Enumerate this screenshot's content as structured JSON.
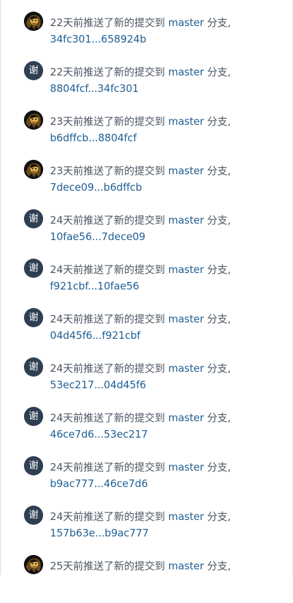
{
  "activities": [
    {
      "avatar_type": "photo",
      "avatar_icon": "user-avatar-icon",
      "prefix": "22天前推送了新的提交到",
      "branch": "master",
      "suffix": "分支,",
      "compare": "34fc301...658924b"
    },
    {
      "avatar_type": "letter",
      "avatar_text": "谢",
      "prefix": "22天前推送了新的提交到",
      "branch": "master",
      "suffix": "分支,",
      "compare": "8804fcf...34fc301"
    },
    {
      "avatar_type": "photo",
      "avatar_icon": "user-avatar-icon",
      "prefix": "23天前推送了新的提交到",
      "branch": "master",
      "suffix": "分支,",
      "compare": "b6dffcb...8804fcf"
    },
    {
      "avatar_type": "photo",
      "avatar_icon": "user-avatar-icon",
      "prefix": "23天前推送了新的提交到",
      "branch": "master",
      "suffix": "分支,",
      "compare": "7dece09...b6dffcb"
    },
    {
      "avatar_type": "letter",
      "avatar_text": "谢",
      "prefix": "24天前推送了新的提交到",
      "branch": "master",
      "suffix": "分支,",
      "compare": "10fae56...7dece09"
    },
    {
      "avatar_type": "letter",
      "avatar_text": "谢",
      "prefix": "24天前推送了新的提交到",
      "branch": "master",
      "suffix": "分支,",
      "compare": "f921cbf...10fae56"
    },
    {
      "avatar_type": "letter",
      "avatar_text": "谢",
      "prefix": "24天前推送了新的提交到",
      "branch": "master",
      "suffix": "分支,",
      "compare": "04d45f6...f921cbf"
    },
    {
      "avatar_type": "letter",
      "avatar_text": "谢",
      "prefix": "24天前推送了新的提交到",
      "branch": "master",
      "suffix": "分支,",
      "compare": "53ec217...04d45f6"
    },
    {
      "avatar_type": "letter",
      "avatar_text": "谢",
      "prefix": "24天前推送了新的提交到",
      "branch": "master",
      "suffix": "分支,",
      "compare": "46ce7d6...53ec217"
    },
    {
      "avatar_type": "letter",
      "avatar_text": "谢",
      "prefix": "24天前推送了新的提交到",
      "branch": "master",
      "suffix": "分支,",
      "compare": "b9ac777...46ce7d6"
    },
    {
      "avatar_type": "letter",
      "avatar_text": "谢",
      "prefix": "24天前推送了新的提交到",
      "branch": "master",
      "suffix": "分支,",
      "compare": "157b63e...b9ac777"
    },
    {
      "avatar_type": "photo",
      "avatar_icon": "user-avatar-icon",
      "prefix": "25天前推送了新的提交到",
      "branch": "master",
      "suffix": "分支,",
      "compare": ""
    }
  ],
  "colors": {
    "text": "#4b5563",
    "link": "#205f93",
    "avatar_letter_bg": "#2f3f53",
    "divider": "#d9dde3"
  }
}
